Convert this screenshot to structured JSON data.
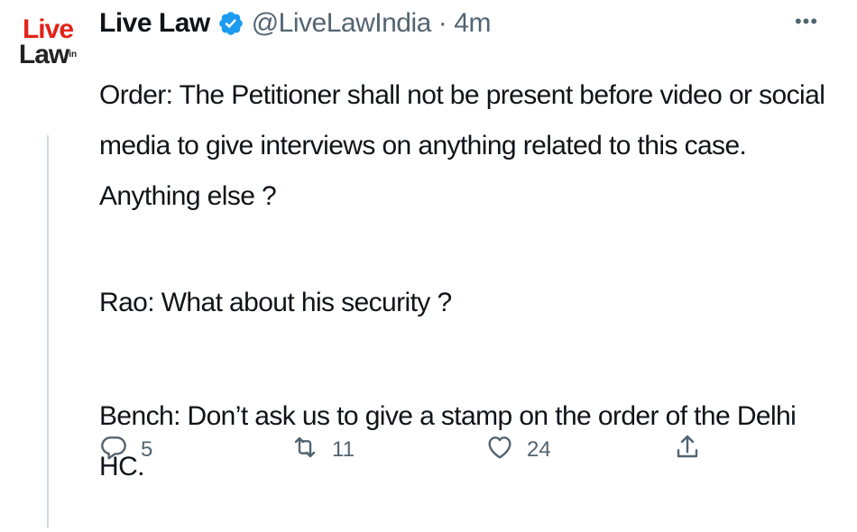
{
  "author": {
    "avatar_logo_top": "Live",
    "avatar_logo_bottom": "Law",
    "avatar_logo_suffix": "in",
    "display_name": "Live Law",
    "handle": "@LiveLawIndia",
    "separator": "·",
    "time": "4m",
    "verified": true
  },
  "menu": {
    "more_label": "•••"
  },
  "tweet": {
    "paragraphs": [
      "Order: The Petitioner shall not be present before video or social media to give interviews on anything related to this case. Anything else ?",
      "Rao: What about his security ?",
      "Bench: Don’t ask us to give a stamp on the order of the Delhi HC."
    ]
  },
  "actions": {
    "reply_count": "5",
    "retweet_count": "11",
    "like_count": "24"
  },
  "colors": {
    "text": "#0f1419",
    "secondary": "#536471",
    "verified": "#1d9bf0",
    "brand_red": "#e2231a"
  },
  "icons": {
    "reply": "reply-icon",
    "retweet": "retweet-icon",
    "like": "heart-icon",
    "share": "share-icon",
    "verified": "verified-badge-icon",
    "more": "more-icon"
  }
}
